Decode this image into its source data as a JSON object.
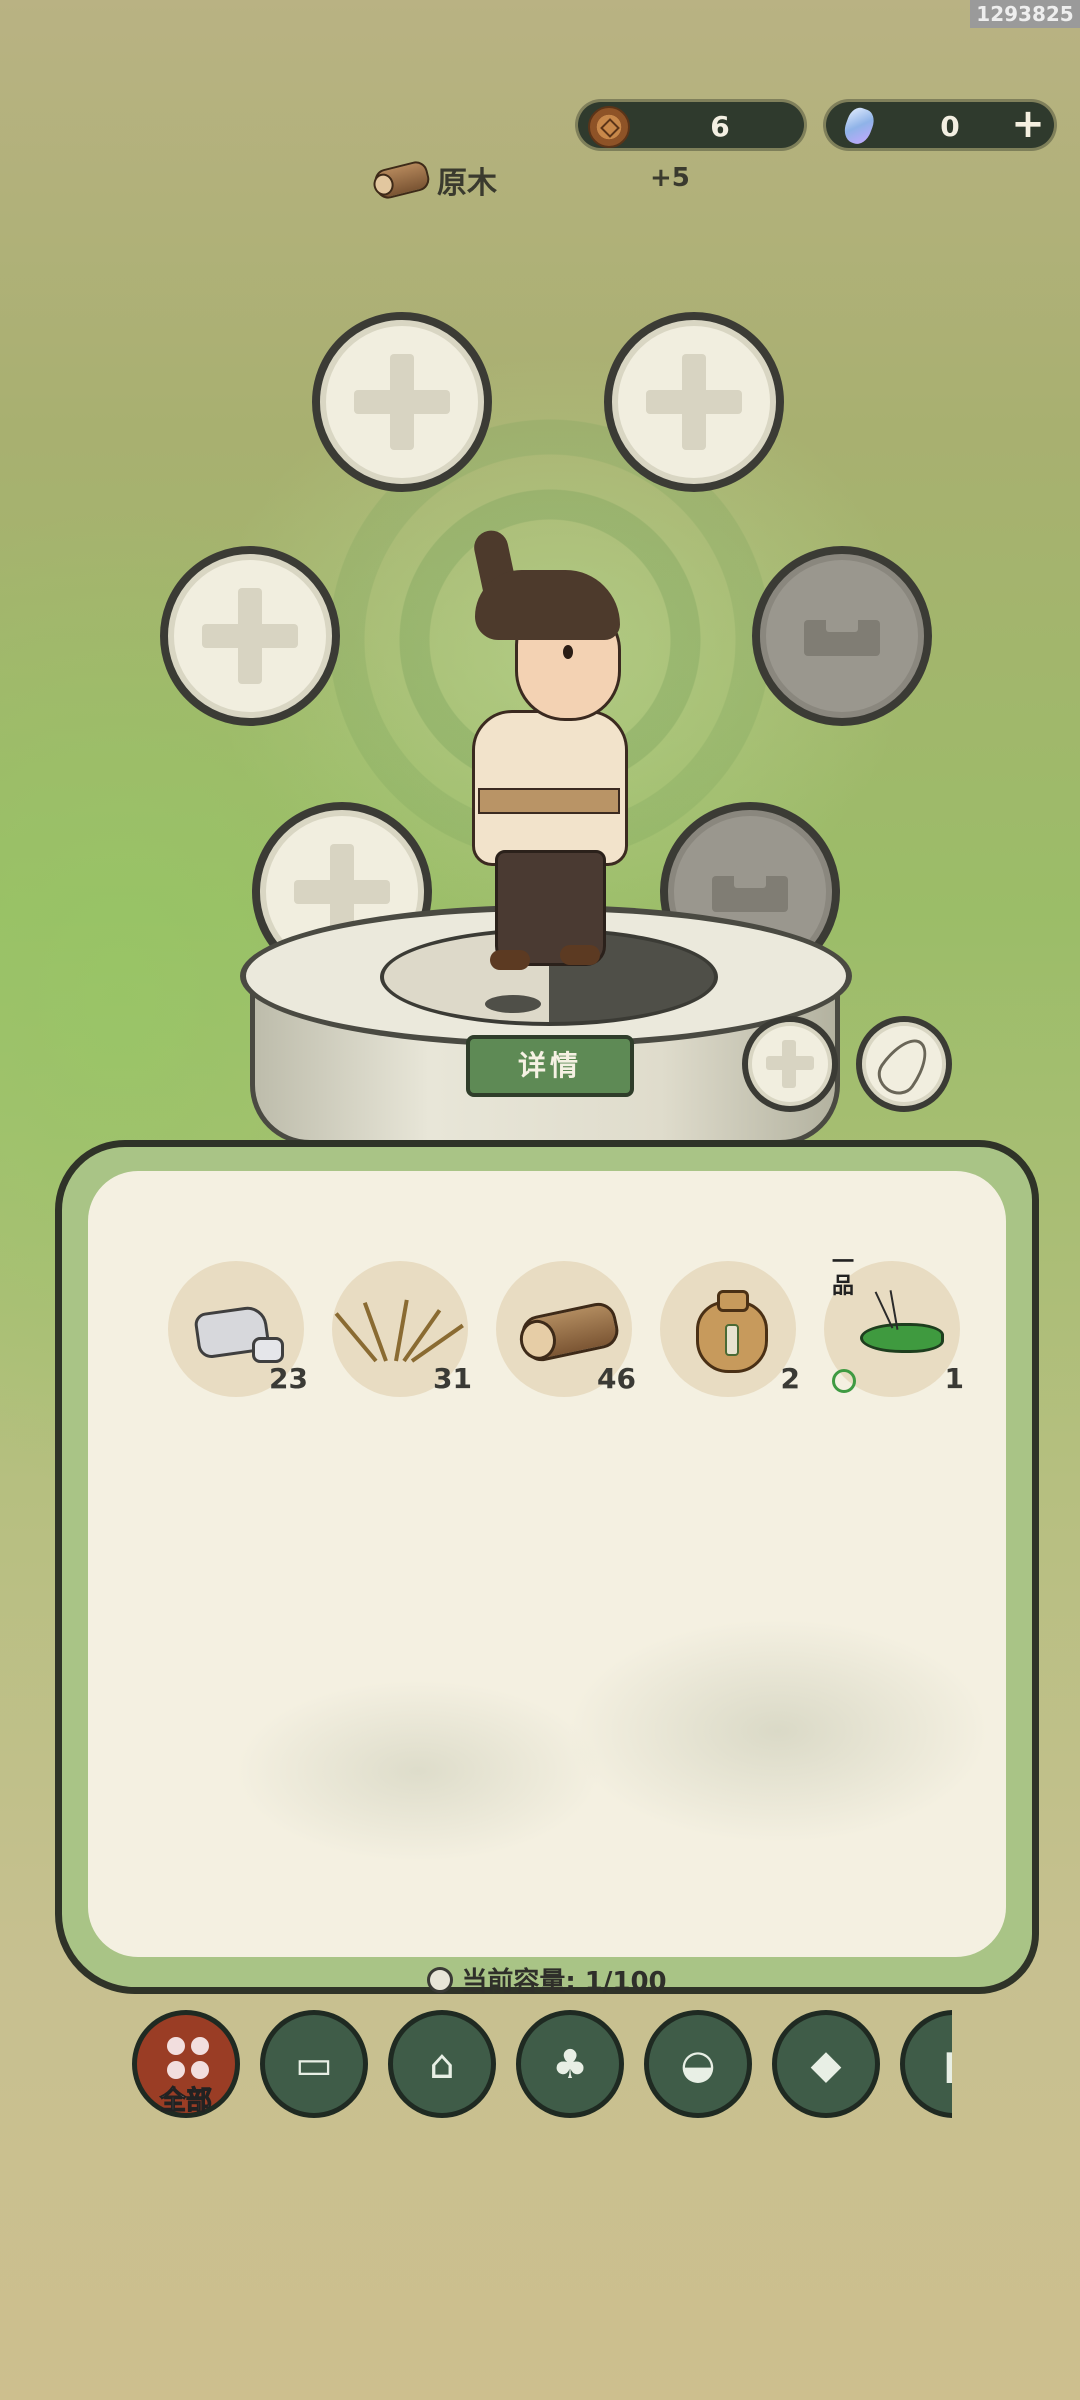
{
  "corner_id": "1293825",
  "currency": {
    "coins": "6",
    "gems": "0",
    "add_label": "+"
  },
  "resource": {
    "name": "原木",
    "gain": "+5"
  },
  "equipment_slots": {
    "empty_label": "+",
    "detail_button": "详情",
    "side_add": "+"
  },
  "inventory": {
    "items": [
      {
        "name": "stone",
        "icon": "stone-icon",
        "count": "23"
      },
      {
        "name": "grass",
        "icon": "grass-bundle-icon",
        "count": "31"
      },
      {
        "name": "log",
        "icon": "log-icon",
        "count": "46"
      },
      {
        "name": "seed bag",
        "icon": "seed-bag-icon",
        "count": "2"
      },
      {
        "name": "cricket",
        "icon": "cricket-icon",
        "count": "1",
        "grade": "一品"
      }
    ],
    "capacity_label": "当前容量: 1/100"
  },
  "tabs": [
    {
      "icon": "all-icon",
      "label": "全部",
      "active": true
    },
    {
      "icon": "wood-icon",
      "label": "",
      "active": false
    },
    {
      "icon": "house-icon",
      "label": "",
      "active": false
    },
    {
      "icon": "herb-icon",
      "label": "",
      "active": false
    },
    {
      "icon": "food-bowl-icon",
      "label": "",
      "active": false
    },
    {
      "icon": "ore-icon",
      "label": "",
      "active": false
    },
    {
      "icon": "scroll-icon",
      "label": "",
      "active": false
    }
  ],
  "colors": {
    "active_tab": "#9a3d25",
    "tab": "#3f5c48",
    "detail_button": "#5e8a55"
  }
}
